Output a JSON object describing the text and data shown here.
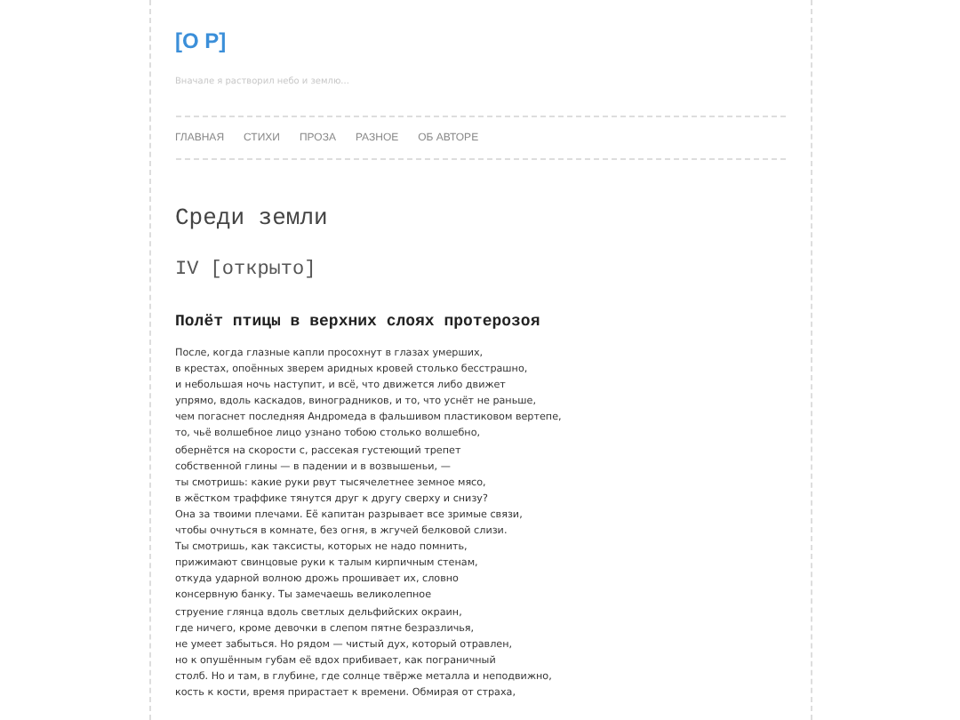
{
  "site": {
    "logo": "[О Р]",
    "tagline": "Вначале я растворил небо и землю..."
  },
  "nav": [
    {
      "label": "ГЛАВНАЯ"
    },
    {
      "label": "СТИХИ"
    },
    {
      "label": "ПРОЗА"
    },
    {
      "label": "РАЗНОЕ"
    },
    {
      "label": "ОБ АВТОРЕ"
    }
  ],
  "post": {
    "title": "Среди земли",
    "subtitle": "IV [открыто]",
    "heading": "Полёт птицы в верхних слоях протерозоя",
    "lines": [
      "После, когда глазные капли просохнут в глазах умерших,",
      "в крестах, опоённых зверем аридных кровей столько бесстрашно,",
      "и небольшая ночь наступит, и всё, что движется либо движет",
      "упрямо, вдоль каскадов, виноградников, и то, что уснёт не раньше,",
      "чем погаснет последняя Андромеда в фальшивом пластиковом вертепе,",
      "то, чьё волшебное лицо узнано тобою столько волшебно,",
      "обернётся на скорости c, рассекая густеющий трепет",
      "собственной глины — в падении и в возвышеньи, —",
      "ты смотришь: какие руки рвут тысячелетнее земное мясо,",
      "в жёстком траффике тянутся друг к другу сверху и снизу?",
      "Она за твоими плечами. Её капитан разрывает все зримые связи,",
      "чтобы очнуться в комнате, без огня, в жгучей белковой слизи.",
      "Ты смотришь, как таксисты, которых не надо помнить,",
      "прижимают свинцовые руки к талым кирпичным стенам,",
      "откуда ударной волною дрожь прошивает их, словно",
      "консервную банку. Ты замечаешь великолепное",
      "струение глянца вдоль светлых дельфийских окраин,",
      "где ничего, кроме девочки в слепом пятне безразличья,",
      "не умеет забыться. Но рядом — чистый дух, который отравлен,",
      "но к опушённым губам её вдох прибивает, как пограничный",
      "столб. Но и там, в глубине, где солнце твёрже металла и неподвижно,",
      "кость к кости, время прирастает к времени. Обмирая от страха,"
    ]
  }
}
